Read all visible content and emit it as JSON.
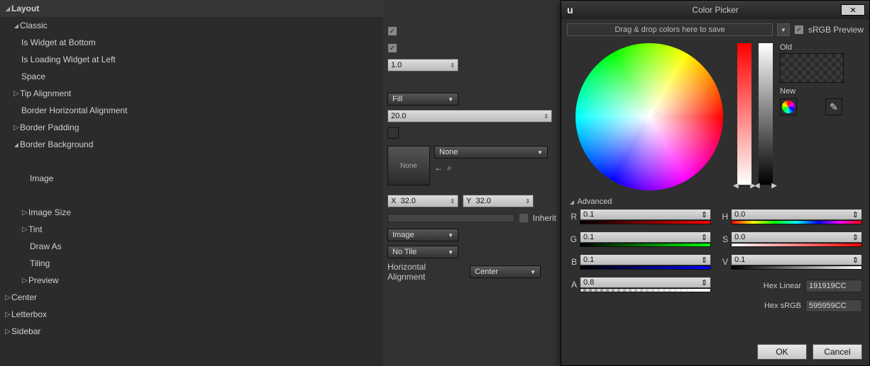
{
  "layout": {
    "header": "Layout",
    "items": [
      {
        "label": "Classic",
        "expanded": true,
        "depth": 0
      },
      {
        "label": "Is Widget at Bottom",
        "depth": 1,
        "control": "checkbox",
        "checked": true
      },
      {
        "label": "Is Loading Widget at Left",
        "depth": 1,
        "control": "checkbox",
        "checked": true
      },
      {
        "label": "Space",
        "depth": 1,
        "control": "number",
        "value": "1.0"
      },
      {
        "label": "Tip Alignment",
        "depth": 1,
        "expandable": true
      },
      {
        "label": "Border Horizontal Alignment",
        "depth": 1,
        "control": "dropdown",
        "value": "Fill"
      },
      {
        "label": "Border Padding",
        "depth": 0,
        "expandable": true,
        "control": "number",
        "value": "20.0"
      },
      {
        "label": "Border Background",
        "depth": 0,
        "expanded": true,
        "control": "swatch"
      },
      {
        "label": "Image",
        "depth": 2,
        "control": "asset",
        "value": "None"
      },
      {
        "label": "Image Size",
        "depth": 2,
        "expandable": true,
        "control": "xy",
        "x": "32.0",
        "y": "32.0"
      },
      {
        "label": "Tint",
        "depth": 2,
        "expandable": true,
        "control": "tint",
        "inherit": "Inherit"
      },
      {
        "label": "Draw As",
        "depth": 2,
        "control": "dropdown",
        "value": "Image"
      },
      {
        "label": "Tiling",
        "depth": 2,
        "control": "dropdown",
        "value": "No Tile"
      },
      {
        "label": "Preview",
        "depth": 1,
        "expandable": true,
        "control": "halign_label",
        "halign_label": "Horizontal Alignment",
        "halign_value": "Center"
      },
      {
        "label": "Center",
        "depth": 0,
        "expandable": true
      },
      {
        "label": "Letterbox",
        "depth": 0,
        "expandable": true
      },
      {
        "label": "Sidebar",
        "depth": 0,
        "expandable": true
      }
    ]
  },
  "picker": {
    "title": "Color Picker",
    "logo": "u",
    "close": "✕",
    "drop_text": "Drag & drop colors here to save",
    "srgb_label": "sRGB Preview",
    "old_label": "Old",
    "new_label": "New",
    "advanced": "Advanced",
    "channels": {
      "R": "0.1",
      "G": "0.1",
      "B": "0.1",
      "A": "0.8",
      "H": "0.0",
      "S": "0.0",
      "V": "0.1"
    },
    "hex_linear_label": "Hex Linear",
    "hex_linear": "191919CC",
    "hex_srgb_label": "Hex sRGB",
    "hex_srgb": "595959CC",
    "ok": "OK",
    "cancel": "Cancel"
  },
  "asset": {
    "thumb": "None",
    "dropdown": "None"
  }
}
